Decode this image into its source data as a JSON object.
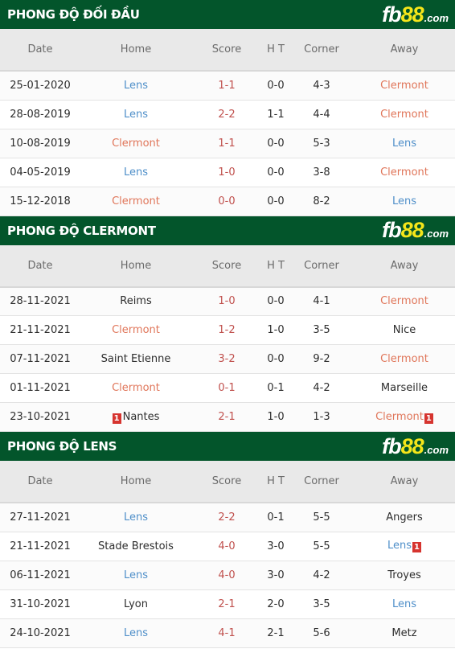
{
  "logo": {
    "fb": "fb",
    "num": "88",
    "dom": ".com"
  },
  "colors": {
    "header_bg": "#03552b",
    "logo_accent": "#f5e61a",
    "lens": "#4f8fc9",
    "clermont": "#e0765a",
    "score": "#c0504d",
    "red_card": "#d6342f"
  },
  "columns": [
    "Date",
    "Home",
    "Score",
    "H T",
    "Corner",
    "Away"
  ],
  "sections": [
    {
      "title": "PHONG ĐỘ ĐỐI ĐẦU",
      "rows": [
        {
          "date": "25-01-2020",
          "home": "Lens",
          "home_team": "lens",
          "score": "1-1",
          "ht": "0-0",
          "corner": "4-3",
          "away": "Clermont",
          "away_team": "clermont"
        },
        {
          "date": "28-08-2019",
          "home": "Lens",
          "home_team": "lens",
          "score": "2-2",
          "ht": "1-1",
          "corner": "4-4",
          "away": "Clermont",
          "away_team": "clermont"
        },
        {
          "date": "10-08-2019",
          "home": "Clermont",
          "home_team": "clermont",
          "score": "1-1",
          "ht": "0-0",
          "corner": "5-3",
          "away": "Lens",
          "away_team": "lens"
        },
        {
          "date": "04-05-2019",
          "home": "Lens",
          "home_team": "lens",
          "score": "1-0",
          "ht": "0-0",
          "corner": "3-8",
          "away": "Clermont",
          "away_team": "clermont"
        },
        {
          "date": "15-12-2018",
          "home": "Clermont",
          "home_team": "clermont",
          "score": "0-0",
          "ht": "0-0",
          "corner": "8-2",
          "away": "Lens",
          "away_team": "lens"
        }
      ]
    },
    {
      "title": "PHONG ĐỘ CLERMONT",
      "rows": [
        {
          "date": "28-11-2021",
          "home": "Reims",
          "home_team": "other",
          "score": "1-0",
          "ht": "0-0",
          "corner": "4-1",
          "away": "Clermont",
          "away_team": "clermont"
        },
        {
          "date": "21-11-2021",
          "home": "Clermont",
          "home_team": "clermont",
          "score": "1-2",
          "ht": "1-0",
          "corner": "3-5",
          "away": "Nice",
          "away_team": "other"
        },
        {
          "date": "07-11-2021",
          "home": "Saint Etienne",
          "home_team": "other",
          "score": "3-2",
          "ht": "0-0",
          "corner": "9-2",
          "away": "Clermont",
          "away_team": "clermont"
        },
        {
          "date": "01-11-2021",
          "home": "Clermont",
          "home_team": "clermont",
          "score": "0-1",
          "ht": "0-1",
          "corner": "4-2",
          "away": "Marseille",
          "away_team": "other"
        },
        {
          "date": "23-10-2021",
          "home": "Nantes",
          "home_team": "other",
          "home_card": "1",
          "score": "2-1",
          "ht": "1-0",
          "corner": "1-3",
          "away": "Clermont",
          "away_team": "clermont",
          "away_card": "1"
        }
      ]
    },
    {
      "title": "PHONG ĐỘ LENS",
      "rows": [
        {
          "date": "27-11-2021",
          "home": "Lens",
          "home_team": "lens",
          "score": "2-2",
          "ht": "0-1",
          "corner": "5-5",
          "away": "Angers",
          "away_team": "other"
        },
        {
          "date": "21-11-2021",
          "home": "Stade Brestois",
          "home_team": "other",
          "score": "4-0",
          "ht": "3-0",
          "corner": "5-5",
          "away": "Lens",
          "away_team": "lens",
          "away_card": "1"
        },
        {
          "date": "06-11-2021",
          "home": "Lens",
          "home_team": "lens",
          "score": "4-0",
          "ht": "3-0",
          "corner": "4-2",
          "away": "Troyes",
          "away_team": "other"
        },
        {
          "date": "31-10-2021",
          "home": "Lyon",
          "home_team": "other",
          "score": "2-1",
          "ht": "2-0",
          "corner": "3-5",
          "away": "Lens",
          "away_team": "lens"
        },
        {
          "date": "24-10-2021",
          "home": "Lens",
          "home_team": "lens",
          "score": "4-1",
          "ht": "2-1",
          "corner": "5-6",
          "away": "Metz",
          "away_team": "other"
        }
      ]
    }
  ]
}
